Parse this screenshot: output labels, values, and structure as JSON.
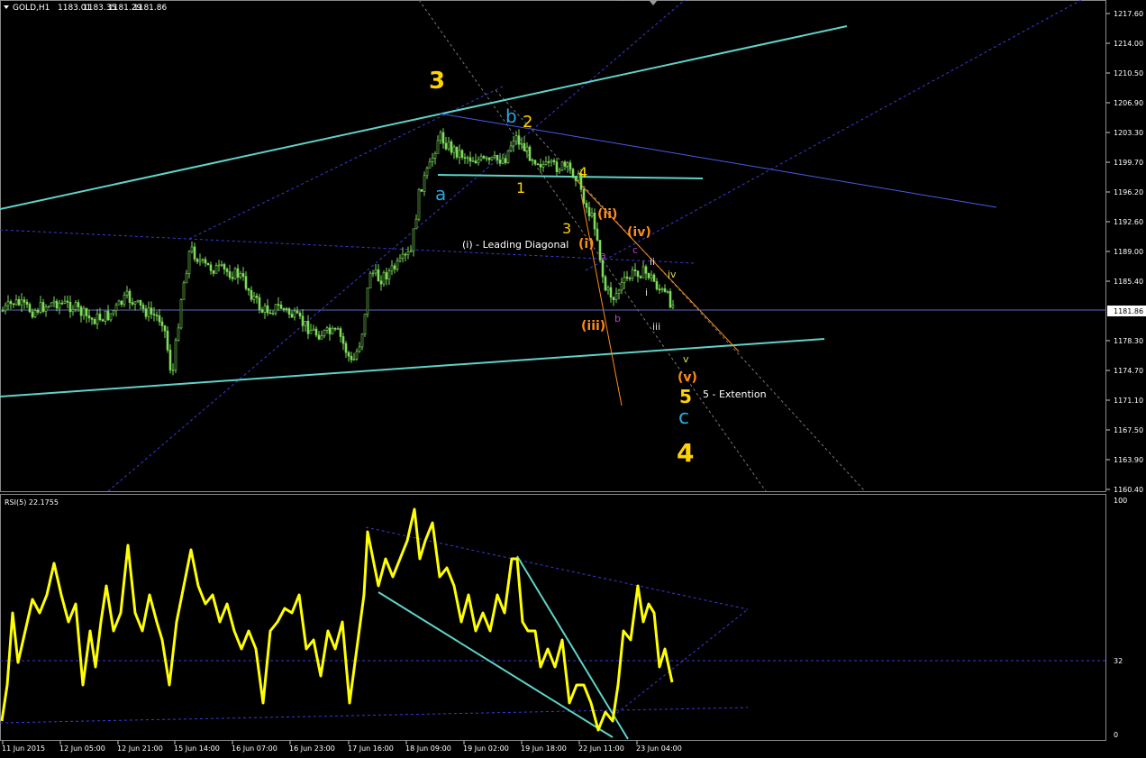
{
  "header": {
    "symbol": "GOLD,H1",
    "open": "1183.01",
    "high": "1183.35",
    "low": "1181.29",
    "close": "1181.86"
  },
  "price_axis": {
    "ticks": [
      "1217.60",
      "1214.00",
      "1210.50",
      "1206.90",
      "1203.30",
      "1199.70",
      "1196.20",
      "1192.60",
      "1189.00",
      "1185.40",
      "1181.86",
      "1178.30",
      "1174.70",
      "1171.10",
      "1167.50",
      "1163.90",
      "1160.40"
    ],
    "current_price": "1181.86"
  },
  "rsi": {
    "title": "RSI(5) 22.1755",
    "levels": [
      "100",
      "32",
      "0"
    ]
  },
  "time_axis": {
    "labels": [
      "11 Jun 2015",
      "12 Jun 05:00",
      "12 Jun 21:00",
      "15 Jun 14:00",
      "16 Jun 07:00",
      "16 Jun 23:00",
      "17 Jun 16:00",
      "18 Jun 09:00",
      "19 Jun 02:00",
      "19 Jun 18:00",
      "22 Jun 11:00",
      "23 Jun 04:00"
    ]
  },
  "annotations": {
    "w3_top": "3",
    "wa": "a",
    "wb": "b",
    "w2": "2",
    "w1": "1",
    "w4_small": "4",
    "w3_small": "3",
    "wave_ii": "(ii)",
    "wave_iv": "(iv)",
    "wave_i": "(i)",
    "wave_iii": "(iii)",
    "wave_v": "(v)",
    "leading_diag": "(i) - Leading Diagonal",
    "sub_a": "a",
    "sub_b": "b",
    "sub_c": "c",
    "sub_ii": "ii",
    "sub_iv": "iv",
    "sub_i": "i",
    "sub_iii": "iii",
    "sub_v": "v",
    "w5": "5",
    "wc": "c",
    "w4_big": "4",
    "extension": "5 - Extention"
  },
  "colors": {
    "background": "#000000",
    "candle": "#7ddc5a",
    "trendline": "#5fd3c8",
    "channel_dash": "#3a3ae0",
    "blue_line": "#4a5be8",
    "rsi_line": "#ffff00",
    "yellow_label": "#ffd200",
    "cyan_label": "#2aa8e0",
    "orange_label": "#ff8c1a",
    "magenta_label": "#c040c0"
  },
  "icons": {
    "dropdown": "triangle-down-icon"
  }
}
